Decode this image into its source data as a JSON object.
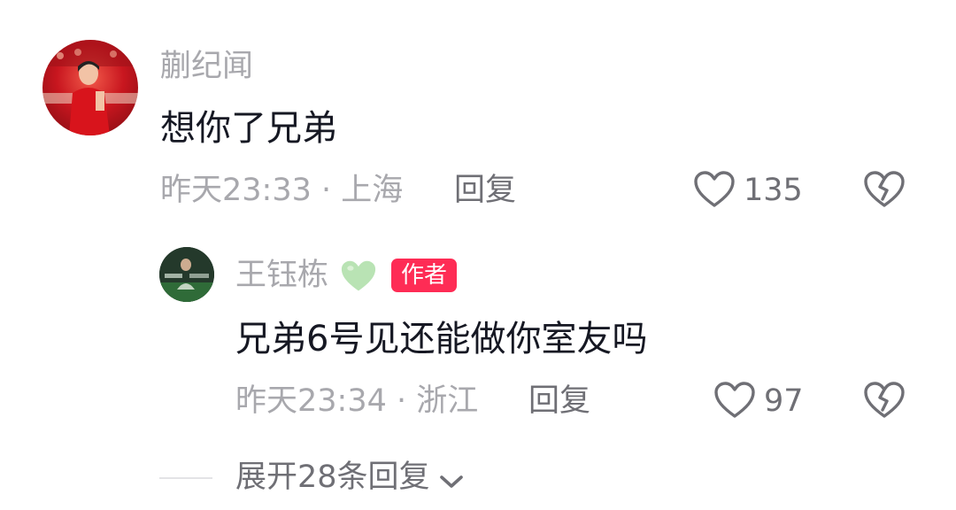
{
  "comment": {
    "author": "蒯纪闻",
    "text": "想你了兄弟",
    "time": "昨天23:33",
    "location": "上海",
    "reply_label": "回复",
    "like_count": "135"
  },
  "reply": {
    "author": "王钰栋",
    "author_emoji": "💚",
    "badge": "作者",
    "text": "兄弟6号见还能做你室友吗",
    "time": "昨天23:34",
    "location": "浙江",
    "reply_label": "回复",
    "like_count": "97"
  },
  "expand_label": "展开28条回复",
  "colors": {
    "badge_bg": "#fe2c55",
    "meta": "#a8a8ad",
    "text": "#161823"
  }
}
